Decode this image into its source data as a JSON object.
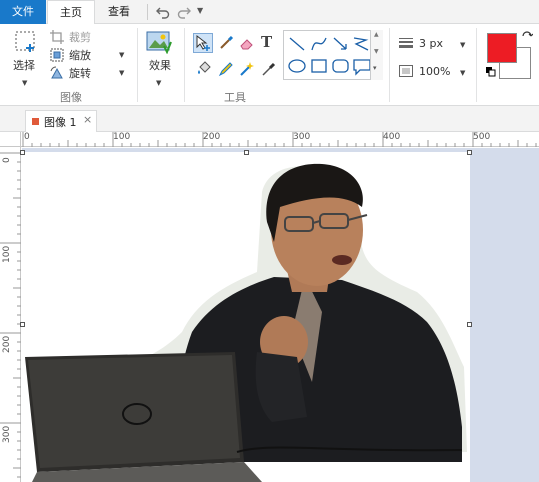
{
  "menu": {
    "file": "文件",
    "home": "主页",
    "view": "查看"
  },
  "quick_access": {
    "undo_icon": "undo-icon",
    "redo_icon": "redo-icon",
    "customize_icon": "chevron-down-icon"
  },
  "ribbon": {
    "image_group": {
      "select_label": "选择",
      "crop_label": "裁剪",
      "resize_label": "缩放",
      "rotate_label": "旋转",
      "group_label": "图像"
    },
    "effects_label": "效果",
    "tools_group": {
      "group_label": "工具",
      "tools": [
        "select-tool",
        "brush-tool",
        "eraser-tool",
        "text-tool",
        "fill-tool",
        "pencil-tool",
        "magic-wand-tool",
        "color-picker-tool"
      ]
    },
    "shapes": [
      "line",
      "curve",
      "arrow",
      "zigzag",
      "ellipse",
      "rectangle",
      "rounded-rectangle",
      "speech-bubble"
    ],
    "stroke_size": "3 px",
    "zoom": "100%",
    "colors": {
      "primary": "#ed1c24",
      "secondary": "#ffffff"
    }
  },
  "document_tab": {
    "name": "图像 1",
    "close": "×"
  },
  "ruler": {
    "horizontal": [
      "0",
      "100",
      "200",
      "300",
      "400",
      "500"
    ],
    "vertical": [
      "0",
      "100",
      "200",
      "300"
    ]
  },
  "canvas": {
    "image_description_icon": "photo-content"
  }
}
